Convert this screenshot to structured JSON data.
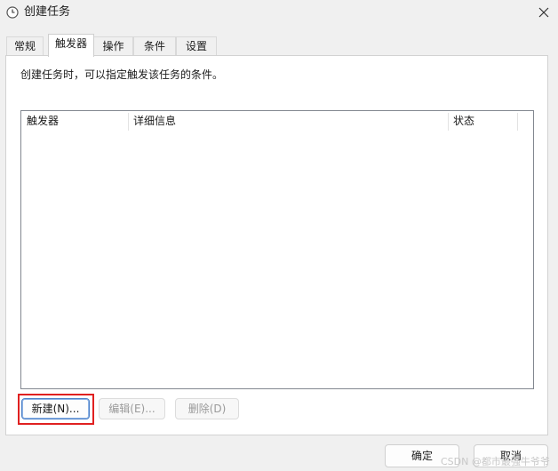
{
  "window": {
    "title": "创建任务"
  },
  "tabs": [
    {
      "label": "常规"
    },
    {
      "label": "触发器"
    },
    {
      "label": "操作"
    },
    {
      "label": "条件"
    },
    {
      "label": "设置"
    }
  ],
  "trigger_tab": {
    "description": "创建任务时，可以指定触发该任务的条件。",
    "columns": [
      "触发器",
      "详细信息",
      "状态"
    ],
    "buttons": {
      "new": "新建(N)...",
      "edit": "编辑(E)...",
      "delete": "删除(D)"
    }
  },
  "footer": {
    "ok": "确定",
    "cancel": "取消"
  },
  "watermark": "CSDN @都市最强牛爷爷",
  "colors": {
    "highlight": "#e02020",
    "primary_border": "#4a7fc7"
  }
}
